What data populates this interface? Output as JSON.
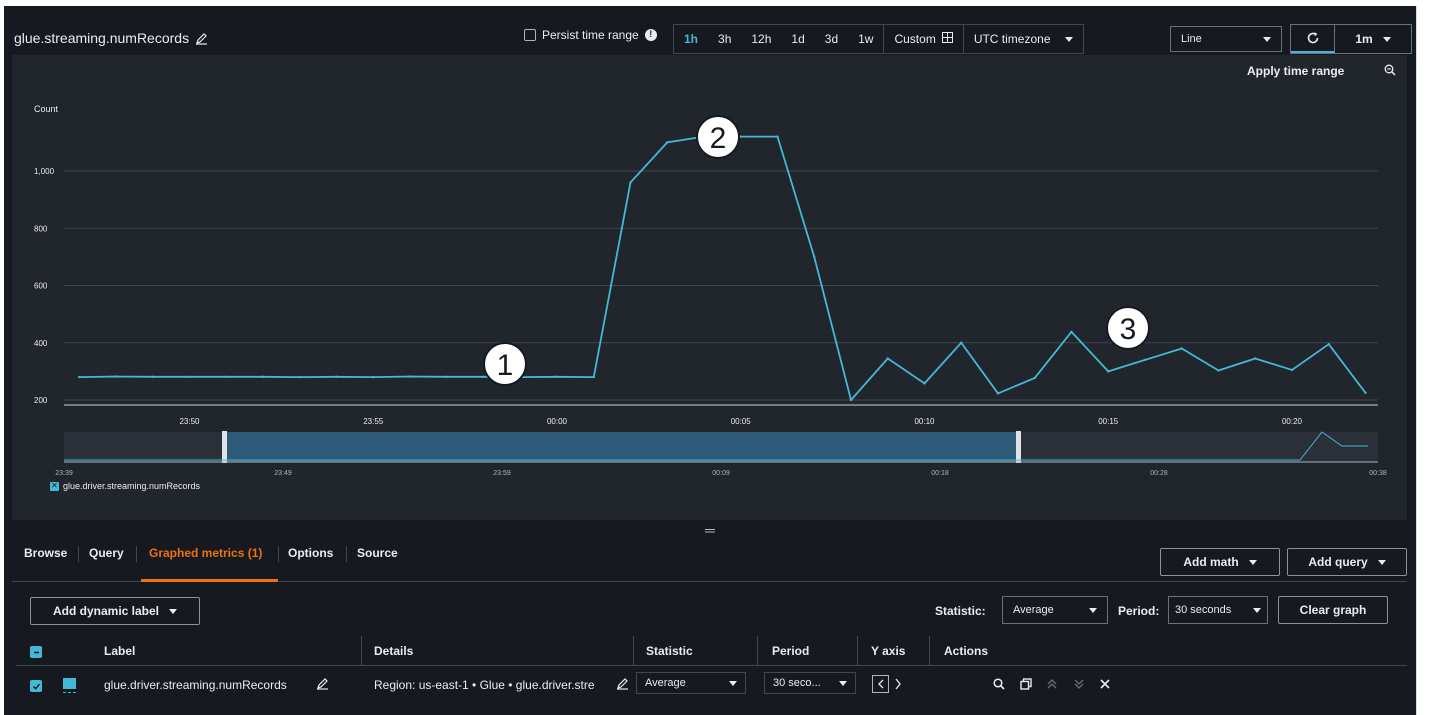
{
  "header": {
    "title": "glue.streaming.numRecords",
    "persist_label": "Persist time range",
    "ranges": [
      "1h",
      "3h",
      "12h",
      "1d",
      "3d",
      "1w"
    ],
    "active_range": "1h",
    "custom_label": "Custom",
    "timezone": "UTC timezone",
    "chart_type": "Line",
    "refresh_interval": "1m"
  },
  "chart": {
    "apply_label": "Apply time range",
    "y_label": "Count",
    "legend_label": "glue.driver.streaming.numRecords",
    "annotations": [
      "1",
      "2",
      "3"
    ],
    "colors": {
      "series": "#44b9d6",
      "annotation_bg": "#ffffff"
    }
  },
  "chart_data": {
    "type": "line",
    "ylabel": "Count",
    "y_ticks": [
      "200",
      "400",
      "600",
      "800",
      "1,000"
    ],
    "x_ticks": [
      "23:50",
      "23:55",
      "00:00",
      "00:05",
      "00:10",
      "00:15",
      "00:20"
    ],
    "ylim": [
      200,
      1200
    ],
    "grid": true,
    "legend": "bottom-left",
    "series": [
      {
        "name": "glue.driver.streaming.numRecords",
        "x_minutes": [
          -13,
          -12,
          -11,
          -10,
          -9,
          -8,
          -7,
          -6,
          -5,
          -4,
          -3,
          -2,
          -1,
          0,
          1,
          2,
          3,
          4,
          5,
          6,
          7,
          8,
          9,
          10,
          11,
          12,
          13,
          14,
          15,
          16,
          17,
          18,
          19,
          20,
          21,
          22
        ],
        "values": [
          280,
          282,
          281,
          281,
          281,
          281,
          280,
          281,
          280,
          282,
          281,
          281,
          280,
          281,
          280,
          960,
          1100,
          1120,
          1120,
          1120,
          700,
          200,
          345,
          258,
          400,
          223,
          277,
          438,
          300,
          340,
          380,
          303,
          345,
          305,
          395,
          225
        ]
      }
    ],
    "overview_ticks": [
      "23:39",
      "23:49",
      "23:59",
      "00:09",
      "00:18",
      "00:28",
      "00:38"
    ]
  },
  "tabs": [
    "Browse",
    "Query",
    "Graphed metrics (1)",
    "Options",
    "Source"
  ],
  "active_tab": "Graphed metrics (1)",
  "actions": {
    "add_math": "Add math",
    "add_query": "Add query",
    "add_dynamic_label": "Add dynamic label",
    "statistic_label": "Statistic:",
    "statistic_value": "Average",
    "period_label": "Period:",
    "period_value": "30 seconds",
    "clear_graph": "Clear graph"
  },
  "table": {
    "columns": [
      "Label",
      "Details",
      "Statistic",
      "Period",
      "Y axis",
      "Actions"
    ],
    "rows": [
      {
        "label": "glue.driver.streaming.numRecords",
        "details": "Region: us-east-1 • Glue • glue.driver.stre",
        "statistic": "Average",
        "period": "30 seco...",
        "color": "#44b9d6"
      }
    ]
  }
}
